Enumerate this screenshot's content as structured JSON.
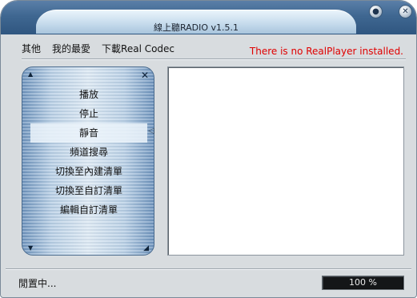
{
  "window": {
    "title": "線上聽RADIO v1.5.1",
    "minimize_glyph": "●",
    "close_glyph": "✕"
  },
  "menu": {
    "items": [
      {
        "label": "其他"
      },
      {
        "label": "我的最愛"
      },
      {
        "label": "下載Real Codec"
      }
    ],
    "warning": "There is no RealPlayer installed.",
    "warning_color": "#e00000"
  },
  "side_panel": {
    "items": [
      {
        "label": "播放"
      },
      {
        "label": "停止"
      },
      {
        "label": "靜音",
        "active": true
      },
      {
        "label": "頻道搜尋"
      },
      {
        "label": "切換至內建清單"
      },
      {
        "label": "切換至自訂清單"
      },
      {
        "label": "編輯自訂清單"
      }
    ],
    "scroll_up_glyph": "▲",
    "scroll_down_glyph": "▼",
    "close_glyph": "✕",
    "resize_glyph": "◢",
    "collapse_glyph": "◁"
  },
  "status": {
    "text": "閒置中...",
    "progress_label": "100 %",
    "progress_value": 1.0
  }
}
